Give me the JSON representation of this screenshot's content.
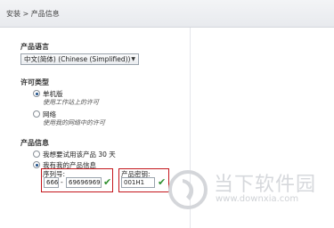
{
  "breadcrumb": {
    "root": "安装",
    "separator": ">",
    "current": "产品信息"
  },
  "language": {
    "title": "产品语言",
    "selected": "中文(简体) (Chinese (Simplified))",
    "arrow_icon": "chevron-down-icon"
  },
  "license": {
    "title": "许可类型",
    "options": [
      {
        "label": "单机版",
        "description": "使用工作站上的许可",
        "checked": true
      },
      {
        "label": "网络",
        "description": "使用我的网络中的许可",
        "checked": false
      }
    ]
  },
  "product_info": {
    "title": "产品信息",
    "options": [
      {
        "label": "我想要试用该产品 30 天",
        "checked": false
      },
      {
        "label": "我有我的产品信息",
        "checked": true
      }
    ],
    "serial_label": "序列号:",
    "serial_prefix": "666",
    "serial_separator": "-",
    "serial_number": "69696969",
    "key_label": "产品密钥:",
    "product_key": "001H1",
    "highlight_color": "#c4161c",
    "check_color": "#2f8f2f"
  },
  "watermark": {
    "title": "当下软件园",
    "url": "www.downxia.com"
  }
}
